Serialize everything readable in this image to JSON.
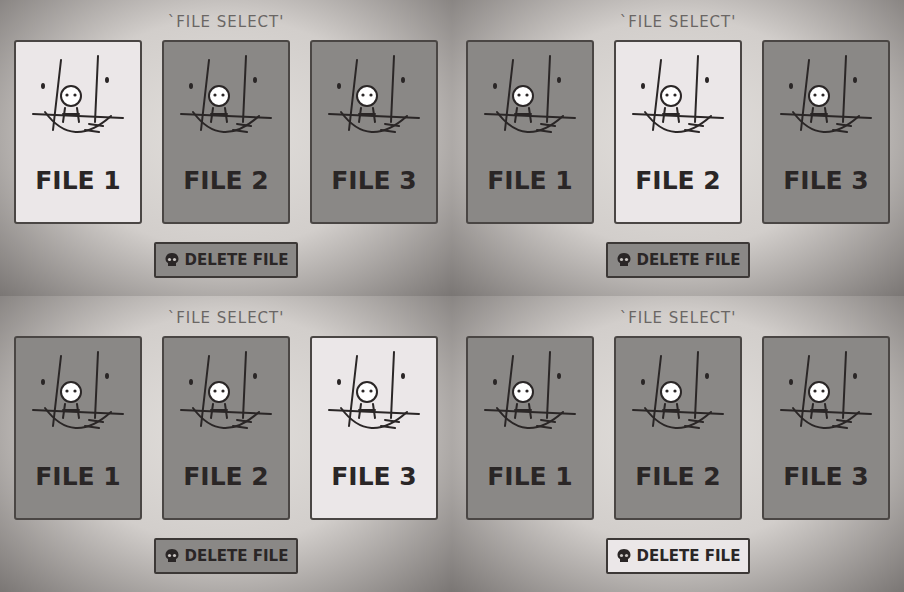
{
  "panels": [
    {
      "title": "`FILE SELECT'",
      "files": [
        {
          "label": "FILE 1",
          "selected": true
        },
        {
          "label": "FILE 2",
          "selected": false
        },
        {
          "label": "FILE 3",
          "selected": false
        }
      ],
      "delete_button": {
        "label": "DELETE FILE",
        "selected": false
      }
    },
    {
      "title": "`FILE SELECT'",
      "files": [
        {
          "label": "FILE 1",
          "selected": false
        },
        {
          "label": "FILE 2",
          "selected": true
        },
        {
          "label": "FILE 3",
          "selected": false
        }
      ],
      "delete_button": {
        "label": "DELETE FILE",
        "selected": false
      }
    },
    {
      "title": "`FILE SELECT'",
      "files": [
        {
          "label": "FILE 1",
          "selected": false
        },
        {
          "label": "FILE 2",
          "selected": false
        },
        {
          "label": "FILE 3",
          "selected": true
        }
      ],
      "delete_button": {
        "label": "DELETE FILE",
        "selected": false
      }
    },
    {
      "title": "`FILE SELECT'",
      "files": [
        {
          "label": "FILE 1",
          "selected": false
        },
        {
          "label": "FILE 2",
          "selected": false
        },
        {
          "label": "FILE 3",
          "selected": false
        }
      ],
      "delete_button": {
        "label": "DELETE FILE",
        "selected": true
      }
    }
  ]
}
